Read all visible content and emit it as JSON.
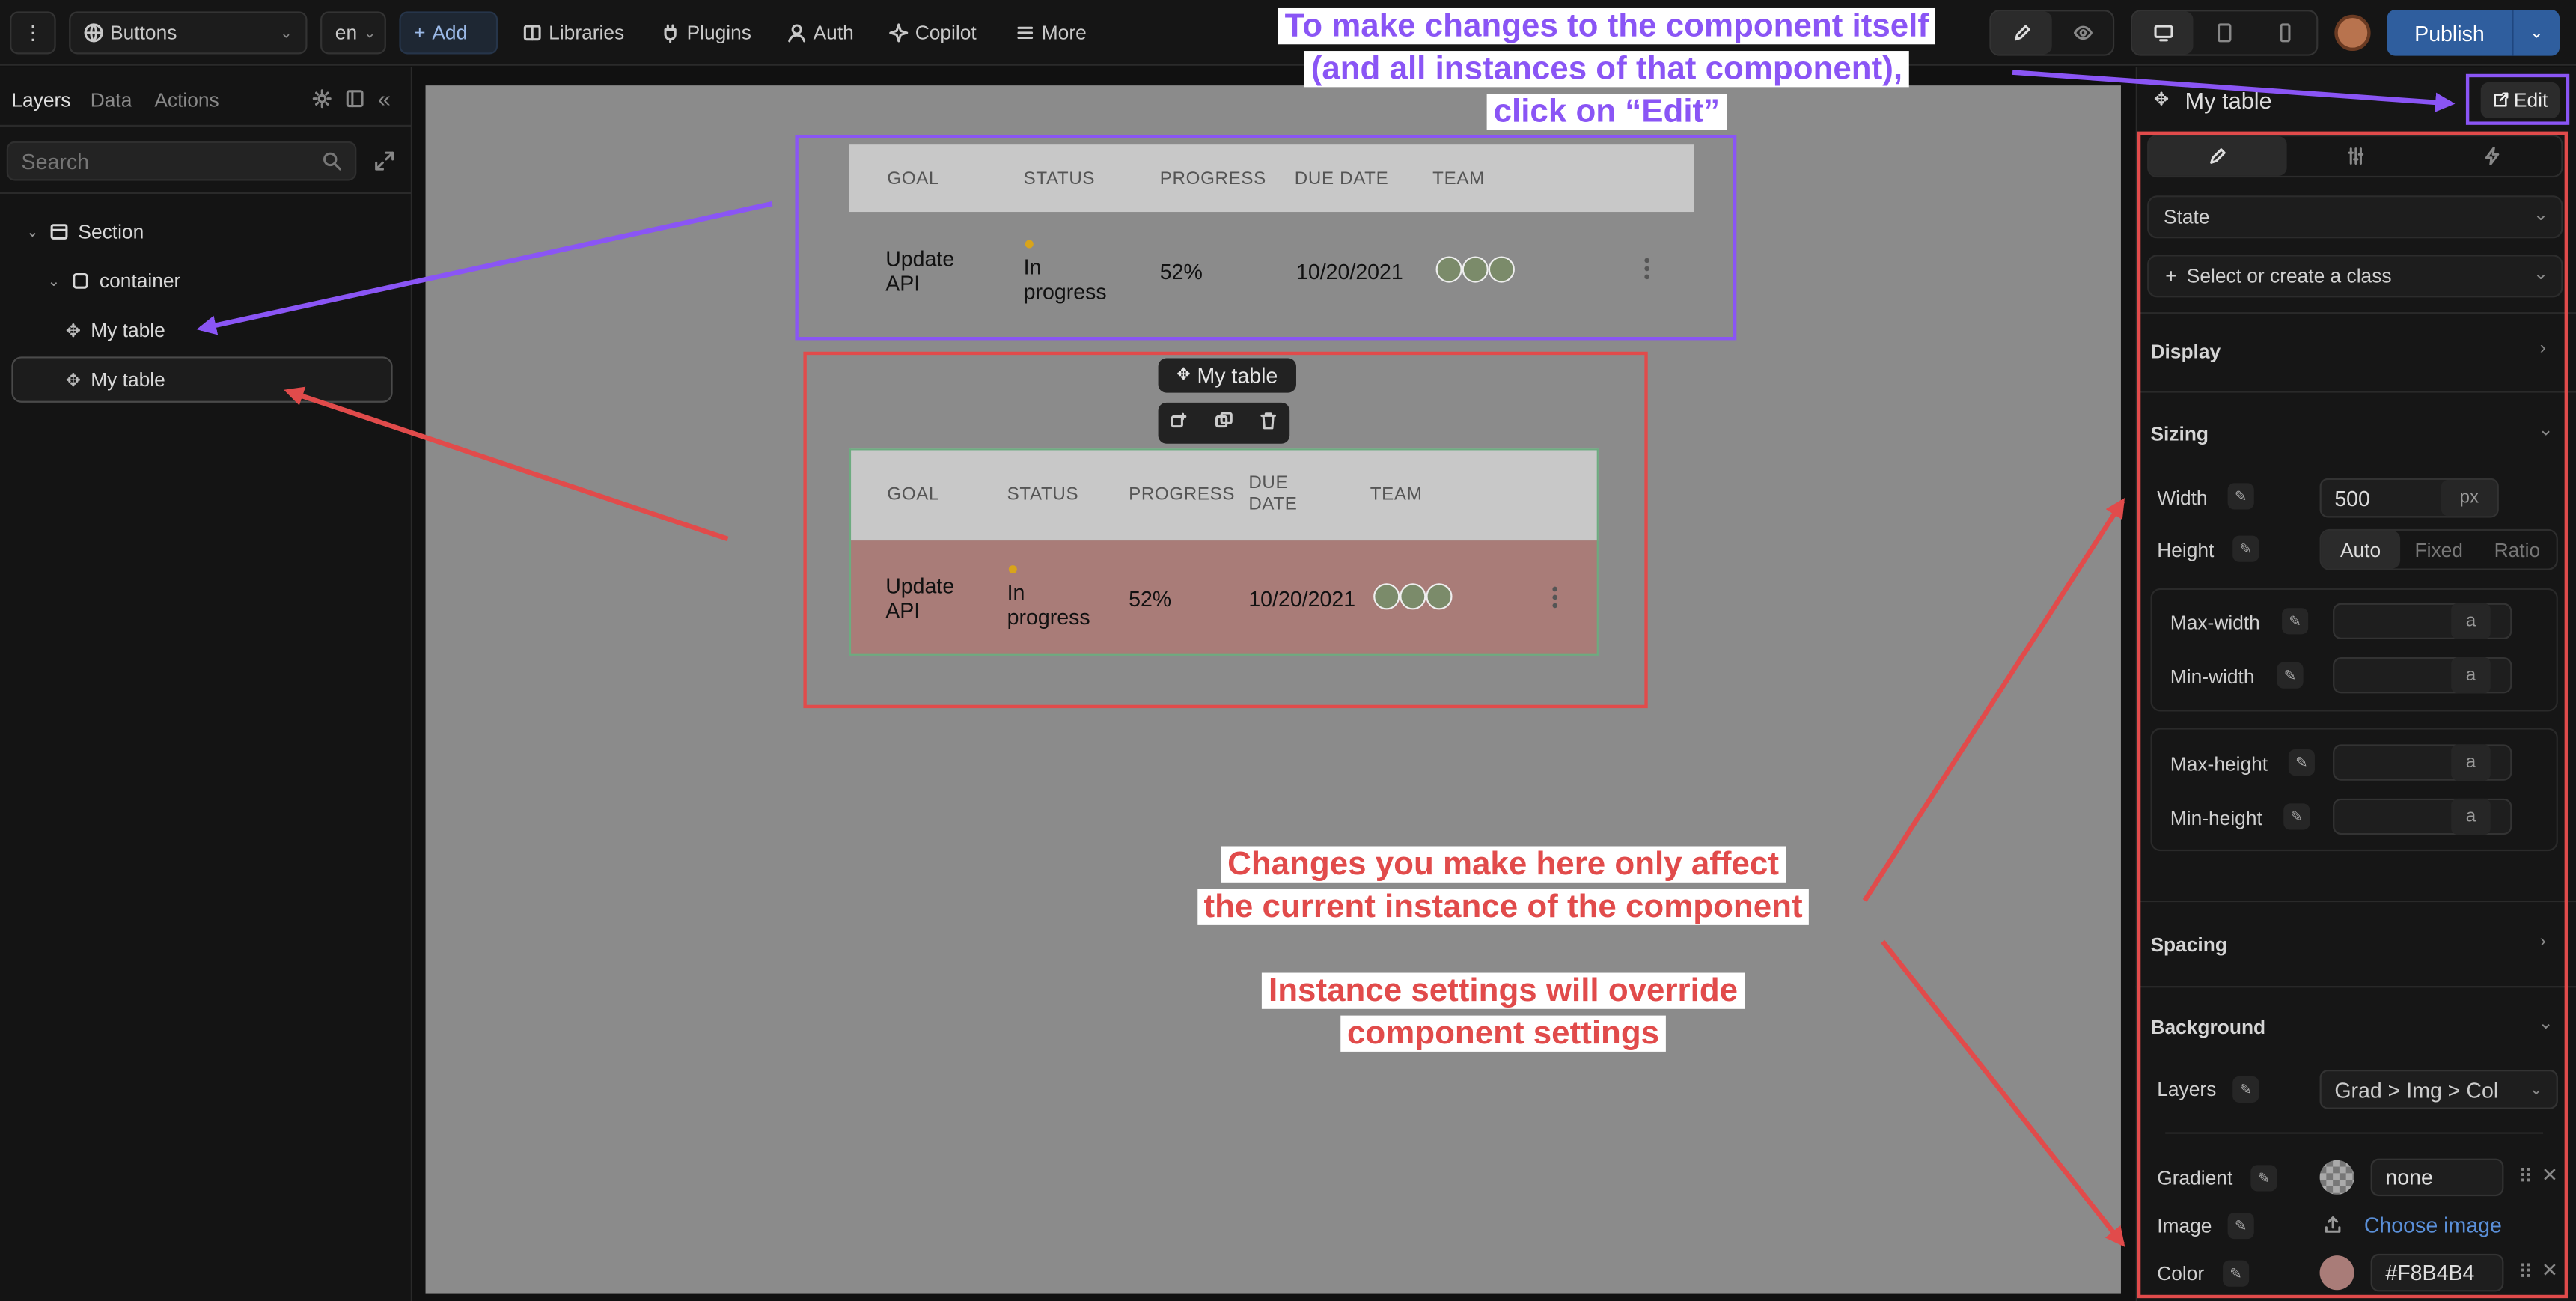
{
  "topbar": {
    "menu": "⋮",
    "project": "Buttons",
    "lang": "en",
    "add": "Add",
    "libraries": "Libraries",
    "plugins": "Plugins",
    "auth": "Auth",
    "copilot": "Copilot",
    "more": "More",
    "publish": "Publish"
  },
  "left": {
    "tabs": [
      "Layers",
      "Data",
      "Actions"
    ],
    "search_placeholder": "Search",
    "layers": [
      "Section",
      "container",
      "My table",
      "My table"
    ]
  },
  "canvas": {
    "selection_label": "My table",
    "headers": [
      "GOAL",
      "STATUS",
      "PROGRESS",
      "DUE DATE",
      "TEAM"
    ],
    "row": {
      "goal": "Update API",
      "status": "In progress",
      "progress": "52%",
      "due": "10/20/2021"
    },
    "due_header_b": [
      "DUE",
      "DATE"
    ]
  },
  "right": {
    "title": "My table",
    "edit": "Edit",
    "state": "State",
    "class": "Select or create a class",
    "display": "Display",
    "sizing": "Sizing",
    "width_label": "Width",
    "width_value": "500",
    "width_unit": "px",
    "height_label": "Height",
    "height_opts": [
      "Auto",
      "Fixed",
      "Ratio"
    ],
    "maxw": "Max-width",
    "minw": "Min-width",
    "maxh": "Max-height",
    "minh": "Min-height",
    "auto_unit": "a",
    "spacing": "Spacing",
    "background": "Background",
    "layers_label": "Layers",
    "layers_value": "Grad > Img > Col",
    "gradient_label": "Gradient",
    "gradient_value": "none",
    "image_label": "Image",
    "image_value": "Choose image",
    "color_label": "Color",
    "color_value": "#F8B4B4"
  },
  "annotations": {
    "edit_note": [
      "To make changes to the component itself",
      "(and all instances of that component),",
      "click on “Edit”"
    ],
    "instance_note": [
      "Changes you make here only affect",
      "the current instance of the component"
    ],
    "override_note": [
      "Instance settings will override",
      "component settings"
    ]
  },
  "colors": {
    "accent_purple": "#8A55F5",
    "annotation_red": "#E14B4B",
    "publish_blue": "#2F5E9E",
    "row_highlight": "#A97C78"
  }
}
